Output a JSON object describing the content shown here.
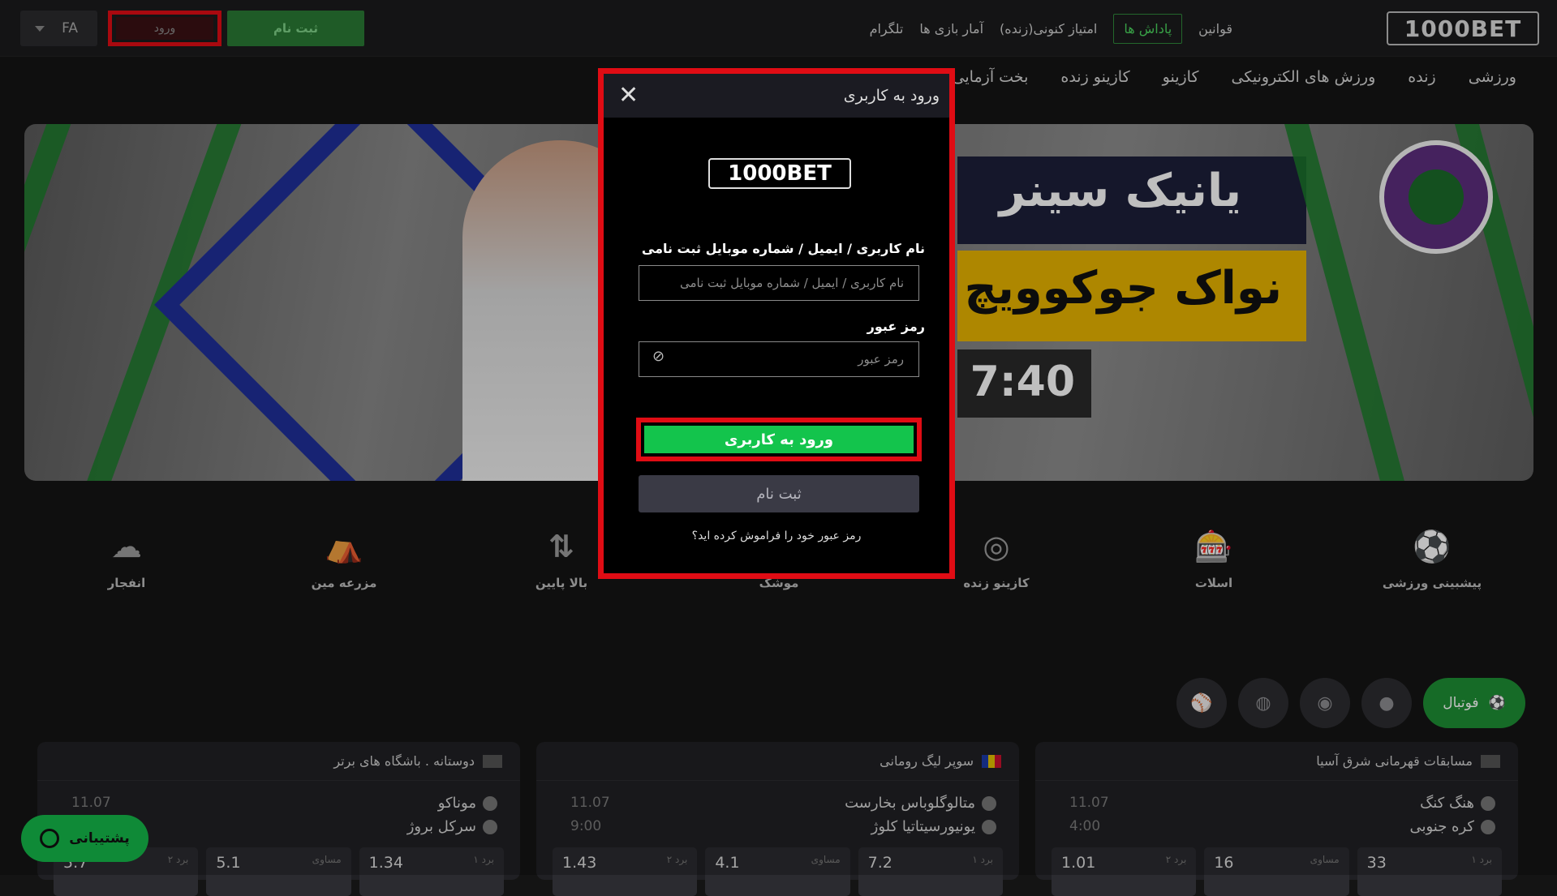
{
  "topbar": {
    "lang": "FA",
    "login_label": "ورود",
    "signup_label": "ثبت نام",
    "links": [
      "قوانین",
      "پاداش ها",
      "امتیاز کنونی(زنده)",
      "آمار بازی ها",
      "تلگرام"
    ],
    "logo_text": "1000BET"
  },
  "nav": [
    "ورزشی",
    "زنده",
    "ورزش های الکترونیکی",
    "کازینو",
    "کازینو زنده",
    "بخت آزمایی"
  ],
  "banner": {
    "line1": "یانیک سینر",
    "line2": "نواک جوکوویچ",
    "time": "7:40"
  },
  "categories": [
    {
      "label": "پیشبینی ورزشی",
      "icon": "soccer-ball-icon"
    },
    {
      "label": "اسلات",
      "icon": "slot-machine-icon"
    },
    {
      "label": "کازینو زنده",
      "icon": "live-casino-icon"
    },
    {
      "label": "موشک",
      "icon": "rocket-icon"
    },
    {
      "label": "بالا پایین",
      "icon": "up-down-arrows-icon"
    },
    {
      "label": "مزرعه مین",
      "icon": "mine-field-icon"
    },
    {
      "label": "انفجار",
      "icon": "explosion-icon"
    }
  ],
  "sports": {
    "active": "فوتبال"
  },
  "cards": [
    {
      "league": "مسابقات قهرمانی شرق آسیا",
      "team1": "هنگ کنگ",
      "team2": "کره جنوبی",
      "date": "11.07",
      "time": "4:00",
      "odds": [
        {
          "label": "برد ۱",
          "value": "33"
        },
        {
          "label": "مساوی",
          "value": "16"
        },
        {
          "label": "برد ۲",
          "value": "1.01"
        }
      ]
    },
    {
      "league": "سوپر لیگ رومانی",
      "team1": "متالوگلوباس بخارست",
      "team2": "یونیورسیتاتیا کلوژ",
      "date": "11.07",
      "time": "9:00",
      "odds": [
        {
          "label": "برد ۱",
          "value": "7.2"
        },
        {
          "label": "مساوی",
          "value": "4.1"
        },
        {
          "label": "برد ۲",
          "value": "1.43"
        }
      ]
    },
    {
      "league": "دوستانه . باشگاه های برتر",
      "team1": "موناکو",
      "team2": "سرکل بروژ",
      "date": "11.07",
      "time": "",
      "odds": [
        {
          "label": "برد ۱",
          "value": "1.34"
        },
        {
          "label": "مساوی",
          "value": "5.1"
        },
        {
          "label": "برد ۲",
          "value": "5.7"
        }
      ]
    }
  ],
  "support_label": "پشتیبانی",
  "modal": {
    "title": "ورود به کاربری",
    "logo_text": "1000BET",
    "username_label": "نام کاربری / ایمیل / شماره موبایل ثبت نامی",
    "username_placeholder": "نام کاربری / ایمیل / شماره موبایل ثبت نامی",
    "password_label": "رمز عبور",
    "password_placeholder": "رمز عبور",
    "login_button": "ورود به کاربری",
    "register_button": "ثبت نام",
    "forgot_link": "رمز عبور خود را فراموش کرده اید؟"
  },
  "colors": {
    "accent_green": "#13c44c",
    "highlight_red": "#e00c14"
  }
}
